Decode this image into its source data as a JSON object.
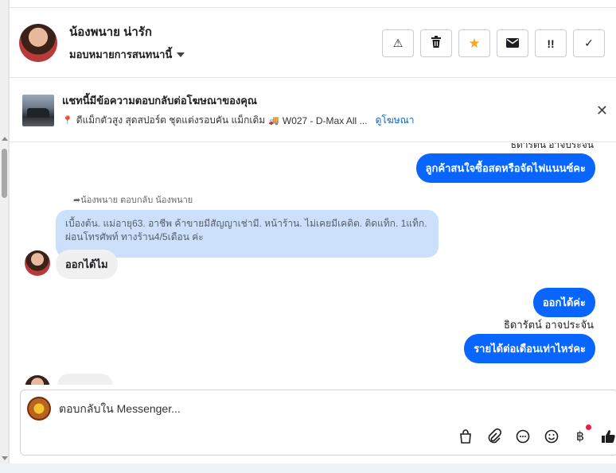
{
  "header": {
    "contact_name": "น้องพนาย น่ารัก",
    "assign_label": "มอบหมายการสนทนานี้",
    "actions": [
      {
        "name": "report-button",
        "icon": "warning-icon",
        "glyph": "⚠"
      },
      {
        "name": "delete-button",
        "icon": "trash-icon",
        "glyph": "🗑"
      },
      {
        "name": "star-button",
        "icon": "star-icon",
        "glyph": "★"
      },
      {
        "name": "mark-unread-button",
        "icon": "envelope-icon",
        "glyph": "✉"
      },
      {
        "name": "mark-spam-button",
        "icon": "exclamation-icon",
        "glyph": "!!"
      },
      {
        "name": "mark-done-button",
        "icon": "check-icon",
        "glyph": "✓"
      }
    ]
  },
  "ad_banner": {
    "title": "แชทนี้มีข้อความตอบกลับต่อโฆษณาของคุณ",
    "subtitle": "ดีแม็กตัวสูง สุดสปอร์ต ชุดแต่งรอบคัน แม็กเดิม",
    "subtitle_code": "W027 - D-Max All ...",
    "link": "ดูโฆษณา",
    "close_glyph": "✕"
  },
  "messages": {
    "clipped_sender": "ธิดารัตน์ อาจประจัน",
    "outgoing_1": "ลูกค้าสนใจซื้อสดหรือจัดไฟแนนซ์คะ",
    "reply_label": "น้องพนาย ตอบกลับ น้องพนาย",
    "reply_quote": "เบื้องต้น. แม่อายุ63. อาชีพ ค้าขายมีสัญญาเช่ามี. หน้าร้าน. ไม่เคยมีเคดิต. ติดแท็ก. 1แท็ก. ผ่อนโทรศัพท์ ทางร้าน4/5เดือน ค่ะ",
    "incoming_1": "ออกได้ไม",
    "outgoing_2": "ออกได้ค่ะ",
    "sender_name": "ธิดารัตน์ อาจประจัน",
    "outgoing_3": "รายได้ต่อเดือนเท่าไหร่คะ"
  },
  "composer": {
    "placeholder": "ตอบกลับใน Messenger...",
    "icons": [
      "shopping-bag-icon",
      "paperclip-icon",
      "chat-bubble-icon",
      "smiley-icon",
      "baht-icon",
      "thumbs-up-icon"
    ],
    "baht_glyph": "฿"
  },
  "colors": {
    "outgoing_bubble": "#0866ff",
    "quote_bubble": "#cce0fb",
    "incoming_bubble": "#f0f0f0",
    "star": "#f5a623"
  }
}
